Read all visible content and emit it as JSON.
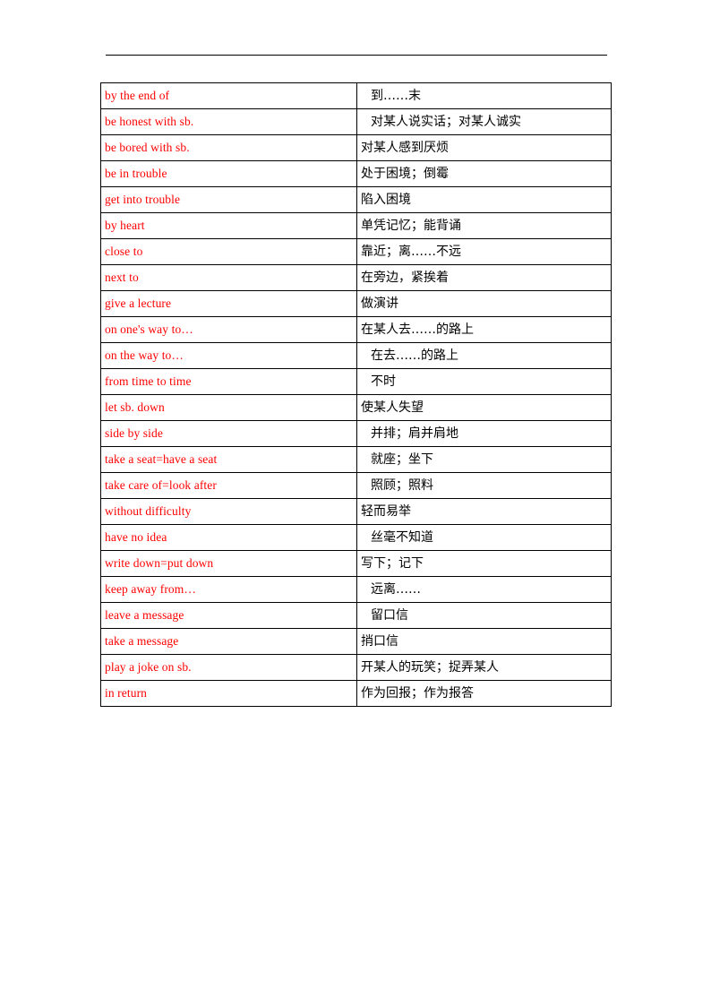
{
  "document": {
    "type": "vocabulary-phrase-table",
    "header_rule_visible": true,
    "english_text_color": "#ff0000",
    "chinese_text_color": "#000000",
    "table_border_color": "#000000",
    "columns": [
      "english_phrase",
      "chinese_meaning"
    ],
    "row_count": 24
  },
  "table": {
    "rows": [
      {
        "en": "by the end of",
        "zh": "到……末",
        "indent": true
      },
      {
        "en": "be honest with sb.",
        "zh": "对某人说实话；对某人诚实",
        "indent": true
      },
      {
        "en": "be bored with sb.",
        "zh": "对某人感到厌烦",
        "indent": false
      },
      {
        "en": "be in trouble",
        "zh": "处于困境；倒霉",
        "indent": false
      },
      {
        "en": "get into trouble",
        "zh": "陷入困境",
        "indent": false
      },
      {
        "en": "by heart",
        "zh": "单凭记忆；能背诵",
        "indent": false
      },
      {
        "en": "close to",
        "zh": "靠近；离……不远",
        "indent": false
      },
      {
        "en": "next to",
        "zh": "在旁边，紧挨着",
        "indent": false
      },
      {
        "en": "give a lecture",
        "zh": "做演讲",
        "indent": false
      },
      {
        "en": "on one's way to…",
        "zh": "在某人去……的路上",
        "indent": false
      },
      {
        "en": "on the way to…",
        "zh": "在去……的路上",
        "indent": true
      },
      {
        "en": "from time to time",
        "zh": "不时",
        "indent": true
      },
      {
        "en": "let sb. down",
        "zh": "使某人失望",
        "indent": false
      },
      {
        "en": "side by side",
        "zh": "并排；肩并肩地",
        "indent": true
      },
      {
        "en": "take a seat=have a seat",
        "zh": "就座；坐下",
        "indent": true
      },
      {
        "en": "take care of=look after",
        "zh": "照顾；照料",
        "indent": true
      },
      {
        "en": "without difficulty",
        "zh": "轻而易举",
        "indent": false
      },
      {
        "en": "have no idea",
        "zh": "丝毫不知道",
        "indent": true
      },
      {
        "en": "write down=put down",
        "zh": "写下；记下",
        "indent": false
      },
      {
        "en": "keep away from…",
        "zh": "远离……",
        "indent": true
      },
      {
        "en": "leave a message",
        "zh": "留口信",
        "indent": true
      },
      {
        "en": "take a message",
        "zh": "捎口信",
        "indent": false
      },
      {
        "en": "play a joke on sb.",
        "zh": "开某人的玩笑；捉弄某人",
        "indent": false
      },
      {
        "en": "in return",
        "zh": "作为回报；作为报答",
        "indent": false
      }
    ]
  }
}
